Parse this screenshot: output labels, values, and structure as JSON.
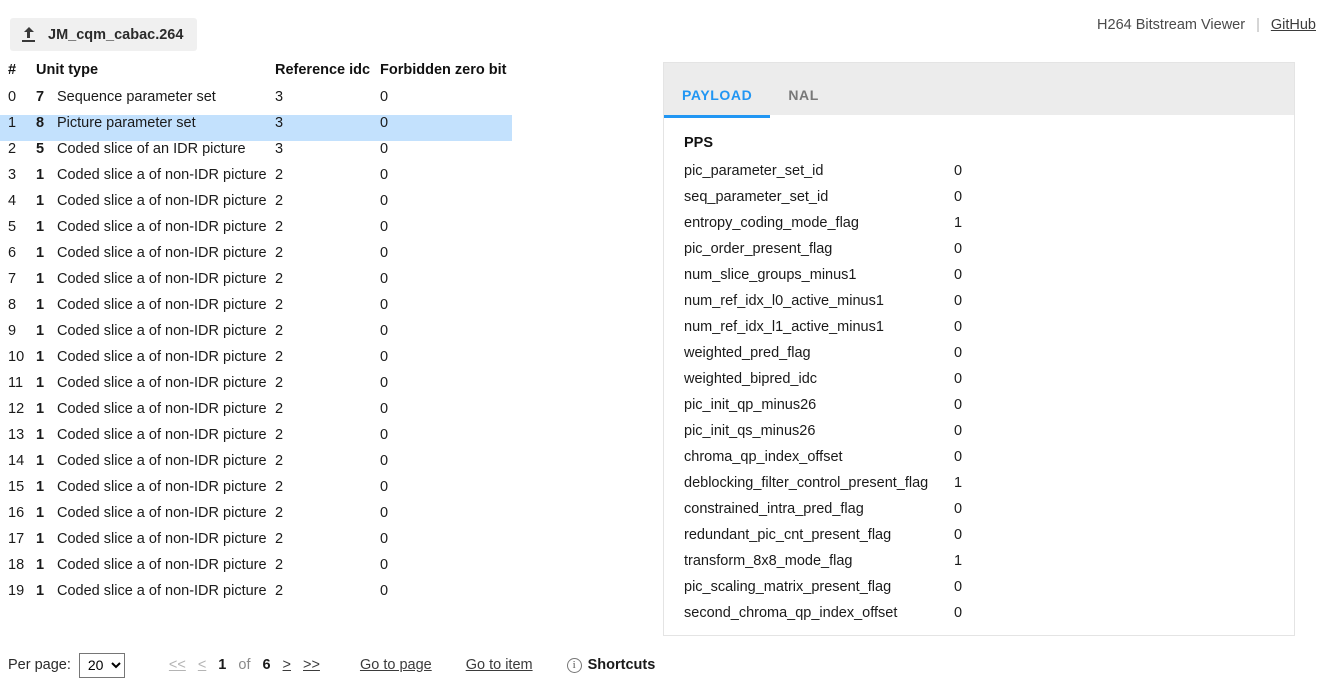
{
  "header": {
    "file_name": "JM_cqm_cabac.264",
    "upload_icon": "upload-icon",
    "app_title": "H264 Bitstream Viewer",
    "separator": "|",
    "github_label": "GitHub"
  },
  "table": {
    "columns": [
      "#",
      "Unit type",
      "Reference idc",
      "Forbidden zero bit"
    ],
    "selected_index": 1,
    "rows": [
      {
        "idx": "0",
        "type": "7",
        "name": "Sequence parameter set",
        "ref": "3",
        "fzb": "0"
      },
      {
        "idx": "1",
        "type": "8",
        "name": "Picture parameter set",
        "ref": "3",
        "fzb": "0"
      },
      {
        "idx": "2",
        "type": "5",
        "name": "Coded slice of an IDR picture",
        "ref": "3",
        "fzb": "0"
      },
      {
        "idx": "3",
        "type": "1",
        "name": "Coded slice a of non-IDR picture",
        "ref": "2",
        "fzb": "0"
      },
      {
        "idx": "4",
        "type": "1",
        "name": "Coded slice a of non-IDR picture",
        "ref": "2",
        "fzb": "0"
      },
      {
        "idx": "5",
        "type": "1",
        "name": "Coded slice a of non-IDR picture",
        "ref": "2",
        "fzb": "0"
      },
      {
        "idx": "6",
        "type": "1",
        "name": "Coded slice a of non-IDR picture",
        "ref": "2",
        "fzb": "0"
      },
      {
        "idx": "7",
        "type": "1",
        "name": "Coded slice a of non-IDR picture",
        "ref": "2",
        "fzb": "0"
      },
      {
        "idx": "8",
        "type": "1",
        "name": "Coded slice a of non-IDR picture",
        "ref": "2",
        "fzb": "0"
      },
      {
        "idx": "9",
        "type": "1",
        "name": "Coded slice a of non-IDR picture",
        "ref": "2",
        "fzb": "0"
      },
      {
        "idx": "10",
        "type": "1",
        "name": "Coded slice a of non-IDR picture",
        "ref": "2",
        "fzb": "0"
      },
      {
        "idx": "11",
        "type": "1",
        "name": "Coded slice a of non-IDR picture",
        "ref": "2",
        "fzb": "0"
      },
      {
        "idx": "12",
        "type": "1",
        "name": "Coded slice a of non-IDR picture",
        "ref": "2",
        "fzb": "0"
      },
      {
        "idx": "13",
        "type": "1",
        "name": "Coded slice a of non-IDR picture",
        "ref": "2",
        "fzb": "0"
      },
      {
        "idx": "14",
        "type": "1",
        "name": "Coded slice a of non-IDR picture",
        "ref": "2",
        "fzb": "0"
      },
      {
        "idx": "15",
        "type": "1",
        "name": "Coded slice a of non-IDR picture",
        "ref": "2",
        "fzb": "0"
      },
      {
        "idx": "16",
        "type": "1",
        "name": "Coded slice a of non-IDR picture",
        "ref": "2",
        "fzb": "0"
      },
      {
        "idx": "17",
        "type": "1",
        "name": "Coded slice a of non-IDR picture",
        "ref": "2",
        "fzb": "0"
      },
      {
        "idx": "18",
        "type": "1",
        "name": "Coded slice a of non-IDR picture",
        "ref": "2",
        "fzb": "0"
      },
      {
        "idx": "19",
        "type": "1",
        "name": "Coded slice a of non-IDR picture",
        "ref": "2",
        "fzb": "0"
      }
    ]
  },
  "footer": {
    "per_page_label": "Per page:",
    "per_page_value": "20",
    "per_page_options": [
      "20"
    ],
    "first_label": "<<",
    "prev_label": "<",
    "current_page": "1",
    "of_label": "of",
    "total_pages": "6",
    "next_label": ">",
    "last_label": ">>",
    "goto_page_label": "Go to page",
    "goto_item_label": "Go to item",
    "shortcuts_label": "Shortcuts",
    "shortcuts_icon": "info-icon",
    "info_glyph": "i"
  },
  "detail": {
    "tabs": [
      {
        "label": "PAYLOAD",
        "active": true
      },
      {
        "label": "NAL",
        "active": false
      }
    ],
    "section_title": "PPS",
    "fields": [
      {
        "key": "pic_parameter_set_id",
        "value": "0"
      },
      {
        "key": "seq_parameter_set_id",
        "value": "0"
      },
      {
        "key": "entropy_coding_mode_flag",
        "value": "1"
      },
      {
        "key": "pic_order_present_flag",
        "value": "0"
      },
      {
        "key": "num_slice_groups_minus1",
        "value": "0"
      },
      {
        "key": "num_ref_idx_l0_active_minus1",
        "value": "0"
      },
      {
        "key": "num_ref_idx_l1_active_minus1",
        "value": "0"
      },
      {
        "key": "weighted_pred_flag",
        "value": "0"
      },
      {
        "key": "weighted_bipred_idc",
        "value": "0"
      },
      {
        "key": "pic_init_qp_minus26",
        "value": "0"
      },
      {
        "key": "pic_init_qs_minus26",
        "value": "0"
      },
      {
        "key": "chroma_qp_index_offset",
        "value": "0"
      },
      {
        "key": "deblocking_filter_control_present_flag",
        "value": "1"
      },
      {
        "key": "constrained_intra_pred_flag",
        "value": "0"
      },
      {
        "key": "redundant_pic_cnt_present_flag",
        "value": "0"
      },
      {
        "key": "transform_8x8_mode_flag",
        "value": "1"
      },
      {
        "key": "pic_scaling_matrix_present_flag",
        "value": "0"
      },
      {
        "key": "second_chroma_qp_index_offset",
        "value": "0"
      }
    ]
  },
  "colors": {
    "accent": "#2196f3",
    "selected_row": "#c3e1fd",
    "tabbar_bg": "#ececec",
    "upload_bg": "#f0f0f0"
  }
}
